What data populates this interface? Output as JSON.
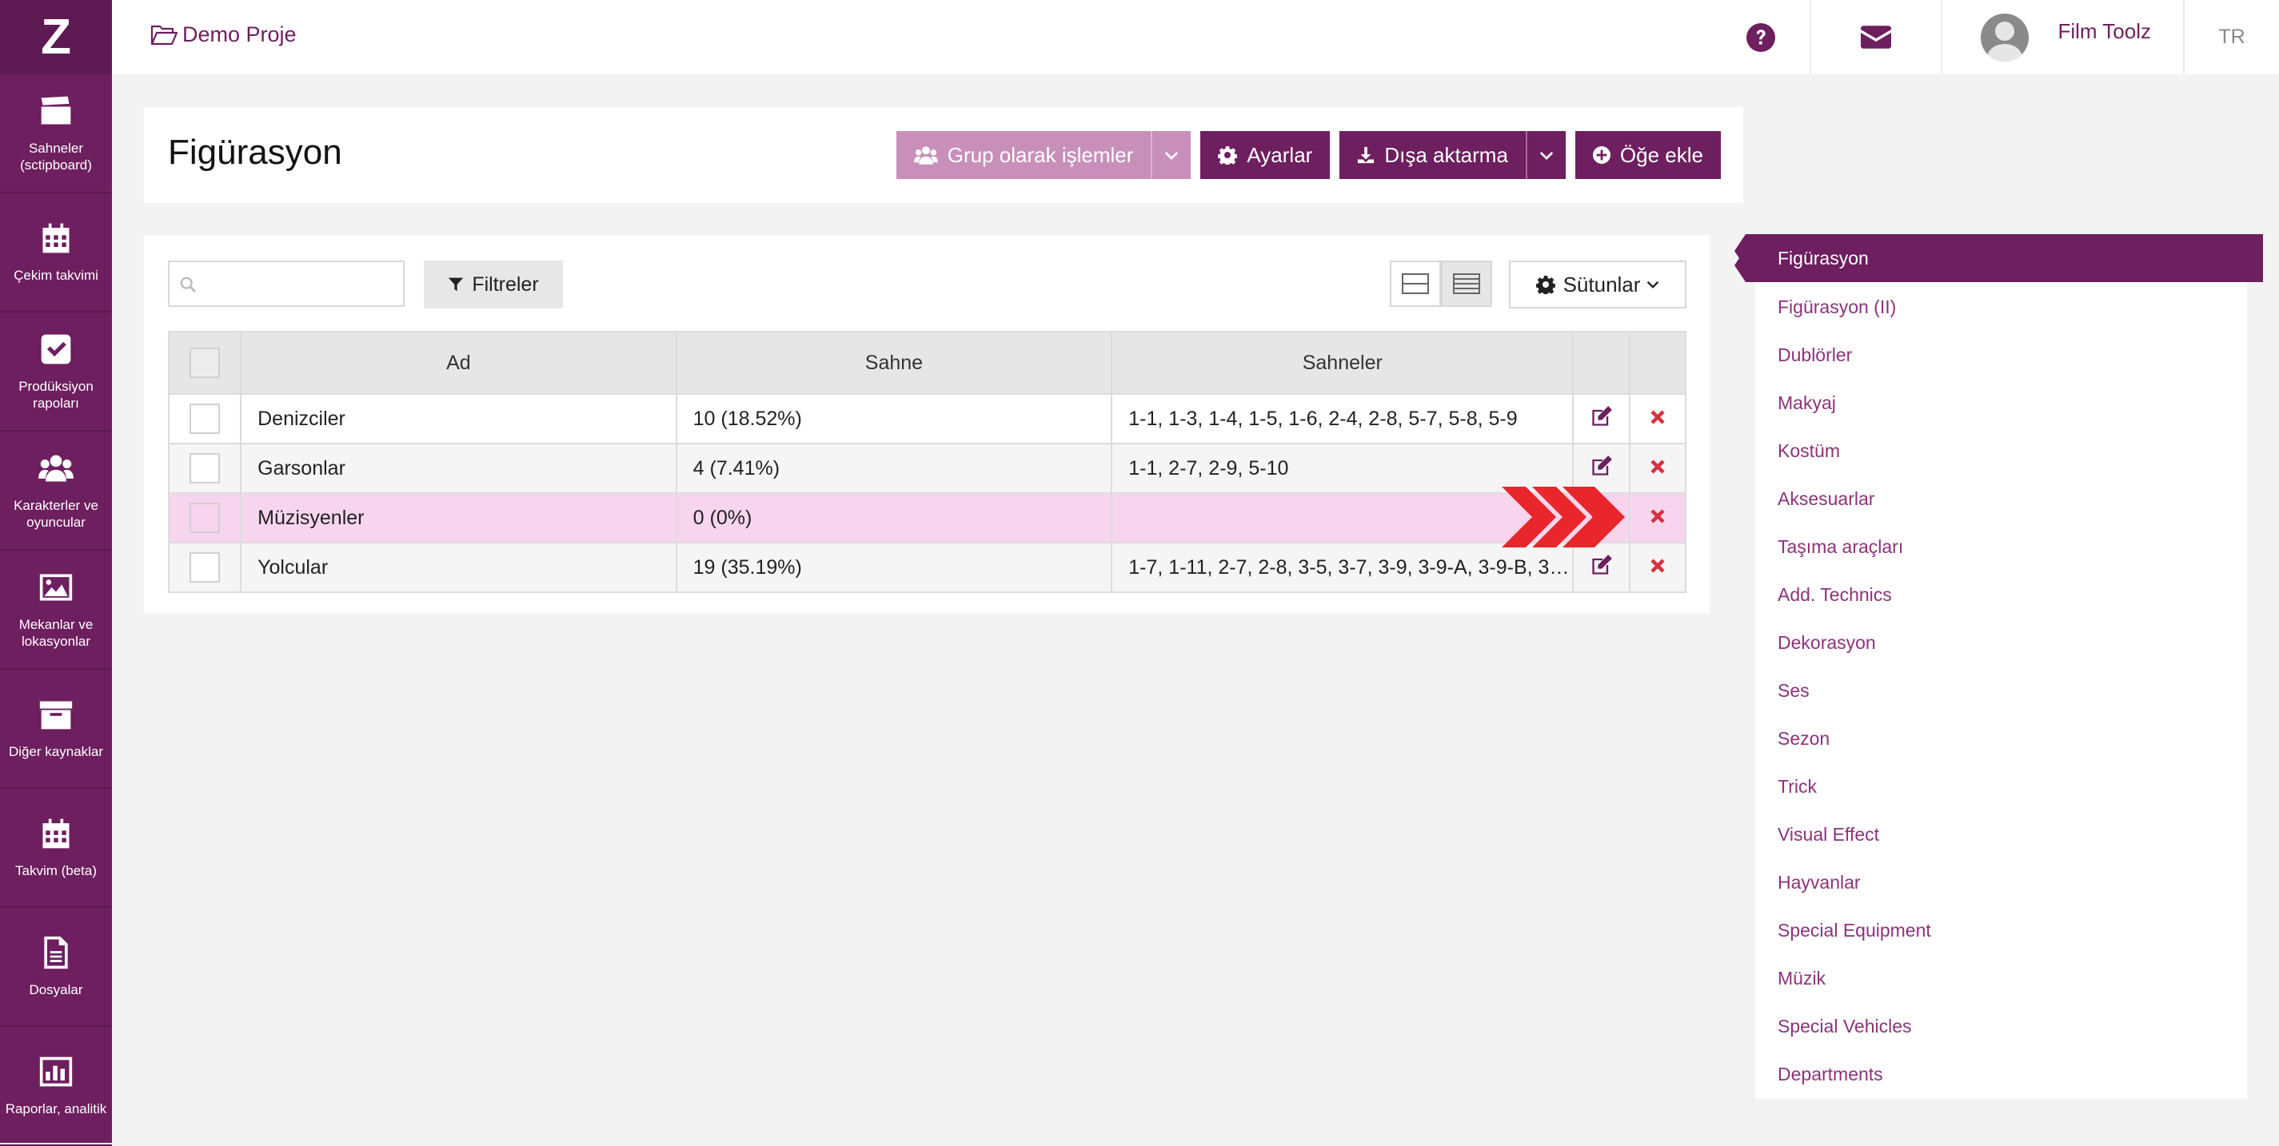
{
  "brand": {
    "logo": "Z"
  },
  "sidebar": {
    "items": [
      {
        "label": "Sahneler (sctipboard)",
        "icon": "clapperboard-icon"
      },
      {
        "label": "Çekim takvimi",
        "icon": "calendar-icon"
      },
      {
        "label": "Prodüksiyon rapoları",
        "icon": "checkbox-icon"
      },
      {
        "label": "Karakterler ve oyuncular",
        "icon": "users-icon"
      },
      {
        "label": "Mekanlar ve lokasyonlar",
        "icon": "image-icon"
      },
      {
        "label": "Diğer kaynaklar",
        "icon": "archive-icon"
      },
      {
        "label": "Takvim (beta)",
        "icon": "calendar-icon"
      },
      {
        "label": "Dosyalar",
        "icon": "file-icon"
      },
      {
        "label": "Raporlar, analitik",
        "icon": "bar-chart-icon"
      }
    ]
  },
  "topbar": {
    "project": "Demo Proje",
    "user": "Film Toolz",
    "lang": "TR"
  },
  "header": {
    "title": "Figürasyon",
    "group_btn": "Grup olarak işlemler",
    "settings_btn": "Ayarlar",
    "export_btn": "Dışa aktarma",
    "add_btn": "Öğe ekle"
  },
  "toolbar": {
    "search_placeholder": "",
    "filters": "Filtreler",
    "columns": "Sütunlar"
  },
  "table": {
    "headers": [
      "Ad",
      "Sahne",
      "Sahneler"
    ],
    "rows": [
      {
        "ad": "Denizciler",
        "sahne": "10 (18.52%)",
        "sahneler": "1-1, 1-3, 1-4, 1-5, 1-6, 2-4, 2-8, 5-7, 5-8, 5-9"
      },
      {
        "ad": "Garsonlar",
        "sahne": "4 (7.41%)",
        "sahneler": "1-1, 2-7, 2-9, 5-10"
      },
      {
        "ad": "Müzisyenler",
        "sahne": "0 (0%)",
        "sahneler": ""
      },
      {
        "ad": "Yolcular",
        "sahne": "19 (35.19%)",
        "sahneler": "1-7, 1-11, 2-7, 2-8, 3-5, 3-7, 3-9, 3-9-A, 3-9-B, 3-1…"
      }
    ]
  },
  "categories": {
    "active": "Figürasyon",
    "items": [
      "Figürasyon (II)",
      "Dublörler",
      "Makyaj",
      "Kostüm",
      "Aksesuarlar",
      "Taşıma araçları",
      "Add. Technics",
      "Dekorasyon",
      "Ses",
      "Sezon",
      "Trick",
      "Visual Effect",
      "Hayvanlar",
      "Special Equipment",
      "Müzik",
      "Special Vehicles",
      "Departments"
    ]
  },
  "colors": {
    "primary": "#6d1f5f",
    "highlight_row": "#f7d5ee",
    "delete": "#d9303f",
    "arrow": "#e8262b"
  }
}
